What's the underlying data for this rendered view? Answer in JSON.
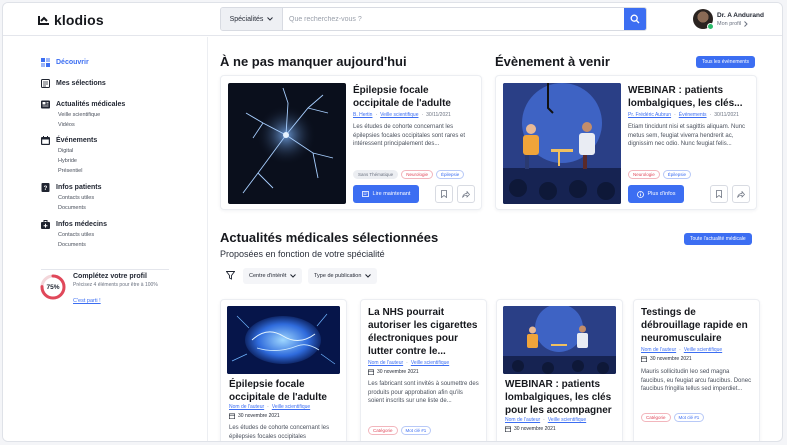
{
  "app": {
    "logo": "klodios"
  },
  "search": {
    "specialty": "Spécialités",
    "placeholder": "Que recherchez-vous ?"
  },
  "user": {
    "name": "Dr. A Andurand",
    "profile_link": "Mon profil"
  },
  "sidebar": {
    "items": [
      {
        "label": "Découvrir",
        "icon": "grid-icon",
        "subs": []
      },
      {
        "label": "Mes sélections",
        "icon": "list-icon",
        "subs": []
      },
      {
        "label": "Actualités médicales",
        "icon": "newspaper-icon",
        "subs": [
          "Veille scientifique",
          "Vidéos"
        ]
      },
      {
        "label": "Événements",
        "icon": "calendar-icon",
        "subs": [
          "Digital",
          "Hybride",
          "Présentiel"
        ]
      },
      {
        "label": "Infos patients",
        "icon": "info-book-icon",
        "subs": [
          "Contacts utiles",
          "Documents"
        ]
      },
      {
        "label": "Infos médecins",
        "icon": "medical-bag-icon",
        "subs": [
          "Contacts utiles",
          "Documents"
        ]
      }
    ],
    "profile": {
      "percent": "75%",
      "progress": 0.75,
      "title": "Complétez votre profil",
      "text": "Précisez 4 éléments pour être à 100%",
      "link": "C'est parti !"
    }
  },
  "must_see": {
    "title": "À ne pas manquer aujourd'hui",
    "card": {
      "title": "Épilepsie focale occipitale de l'adulte",
      "author": "B. Hertin",
      "category": "Veille scientifique",
      "date": "30/11/2021",
      "text": "Les études de cohorte concernant les épilepsies focales occipitales sont rares et intéressent principalement des...",
      "tags": [
        "Sans Thématique",
        "Neurologie",
        "Épilepsie"
      ],
      "cta": "Lire maintenant"
    }
  },
  "event": {
    "title": "Évènement à venir",
    "all_button": "Tous les évènements",
    "card": {
      "title": "WEBINAR : patients lombalgiques, les clés...",
      "author": "Pr. Frédéric Aubrun",
      "category": "Événements",
      "date": "30/11/2021",
      "text": "Etiam tincidunt nisi et sagittis aliquam. Nunc metus sem, feugiat viverra hendrerit ac, dignissim nec odio. Nunc feugiat felis...",
      "tags": [
        "Neurologie",
        "Épilepsie"
      ],
      "cta": "Plus d'infos"
    }
  },
  "news": {
    "title": "Actualités médicales sélectionnées",
    "subtitle": "Proposées en fonction de votre spécialité",
    "all_button": "Toute l'actualité médicale",
    "filters": [
      "Centre d'intérêt",
      "Type de publication"
    ],
    "cards": [
      {
        "title": "Épilepsie focale occipitale de l'adulte",
        "author": "Nom de l'auteur",
        "category": "Veille scientifique",
        "date": "30 novembre 2021",
        "text": "Les études de cohorte concernant les épilepsies focales occipitales"
      },
      {
        "title": "La NHS pourrait autoriser les cigarettes électroniques pour lutter contre le...",
        "author": "Nom de l'auteur",
        "category": "Veille scientifique",
        "date": "30 novembre 2021",
        "text": "Les fabricant sont invités à soumettre des produits pour approbation afin qu'ils soient inscrits sur une liste de...",
        "tags": [
          "Catégorie",
          "Mot clé #1"
        ]
      },
      {
        "title": "WEBINAR : patients lombalgiques, les clés pour les accompagner",
        "author": "Nom de l'auteur",
        "category": "Veille scientifique",
        "date": "30 novembre 2021"
      },
      {
        "title": "Testings de débrouillage rapide en neuromusculaire",
        "author": "Nom de l'auteur",
        "category": "Veille scientifique",
        "date": "30 novembre 2021",
        "text": "Mauris sollicitudin leo sed magna faucibus, eu feugiat arcu faucibus. Donec faucibus fringilla tellus sed imperdiet...",
        "tags": [
          "Catégorie",
          "Mot clé #1"
        ]
      }
    ]
  },
  "colors": {
    "accent": "#3c6ef2",
    "progress": "#e0485a",
    "online": "#2dbb6c"
  }
}
